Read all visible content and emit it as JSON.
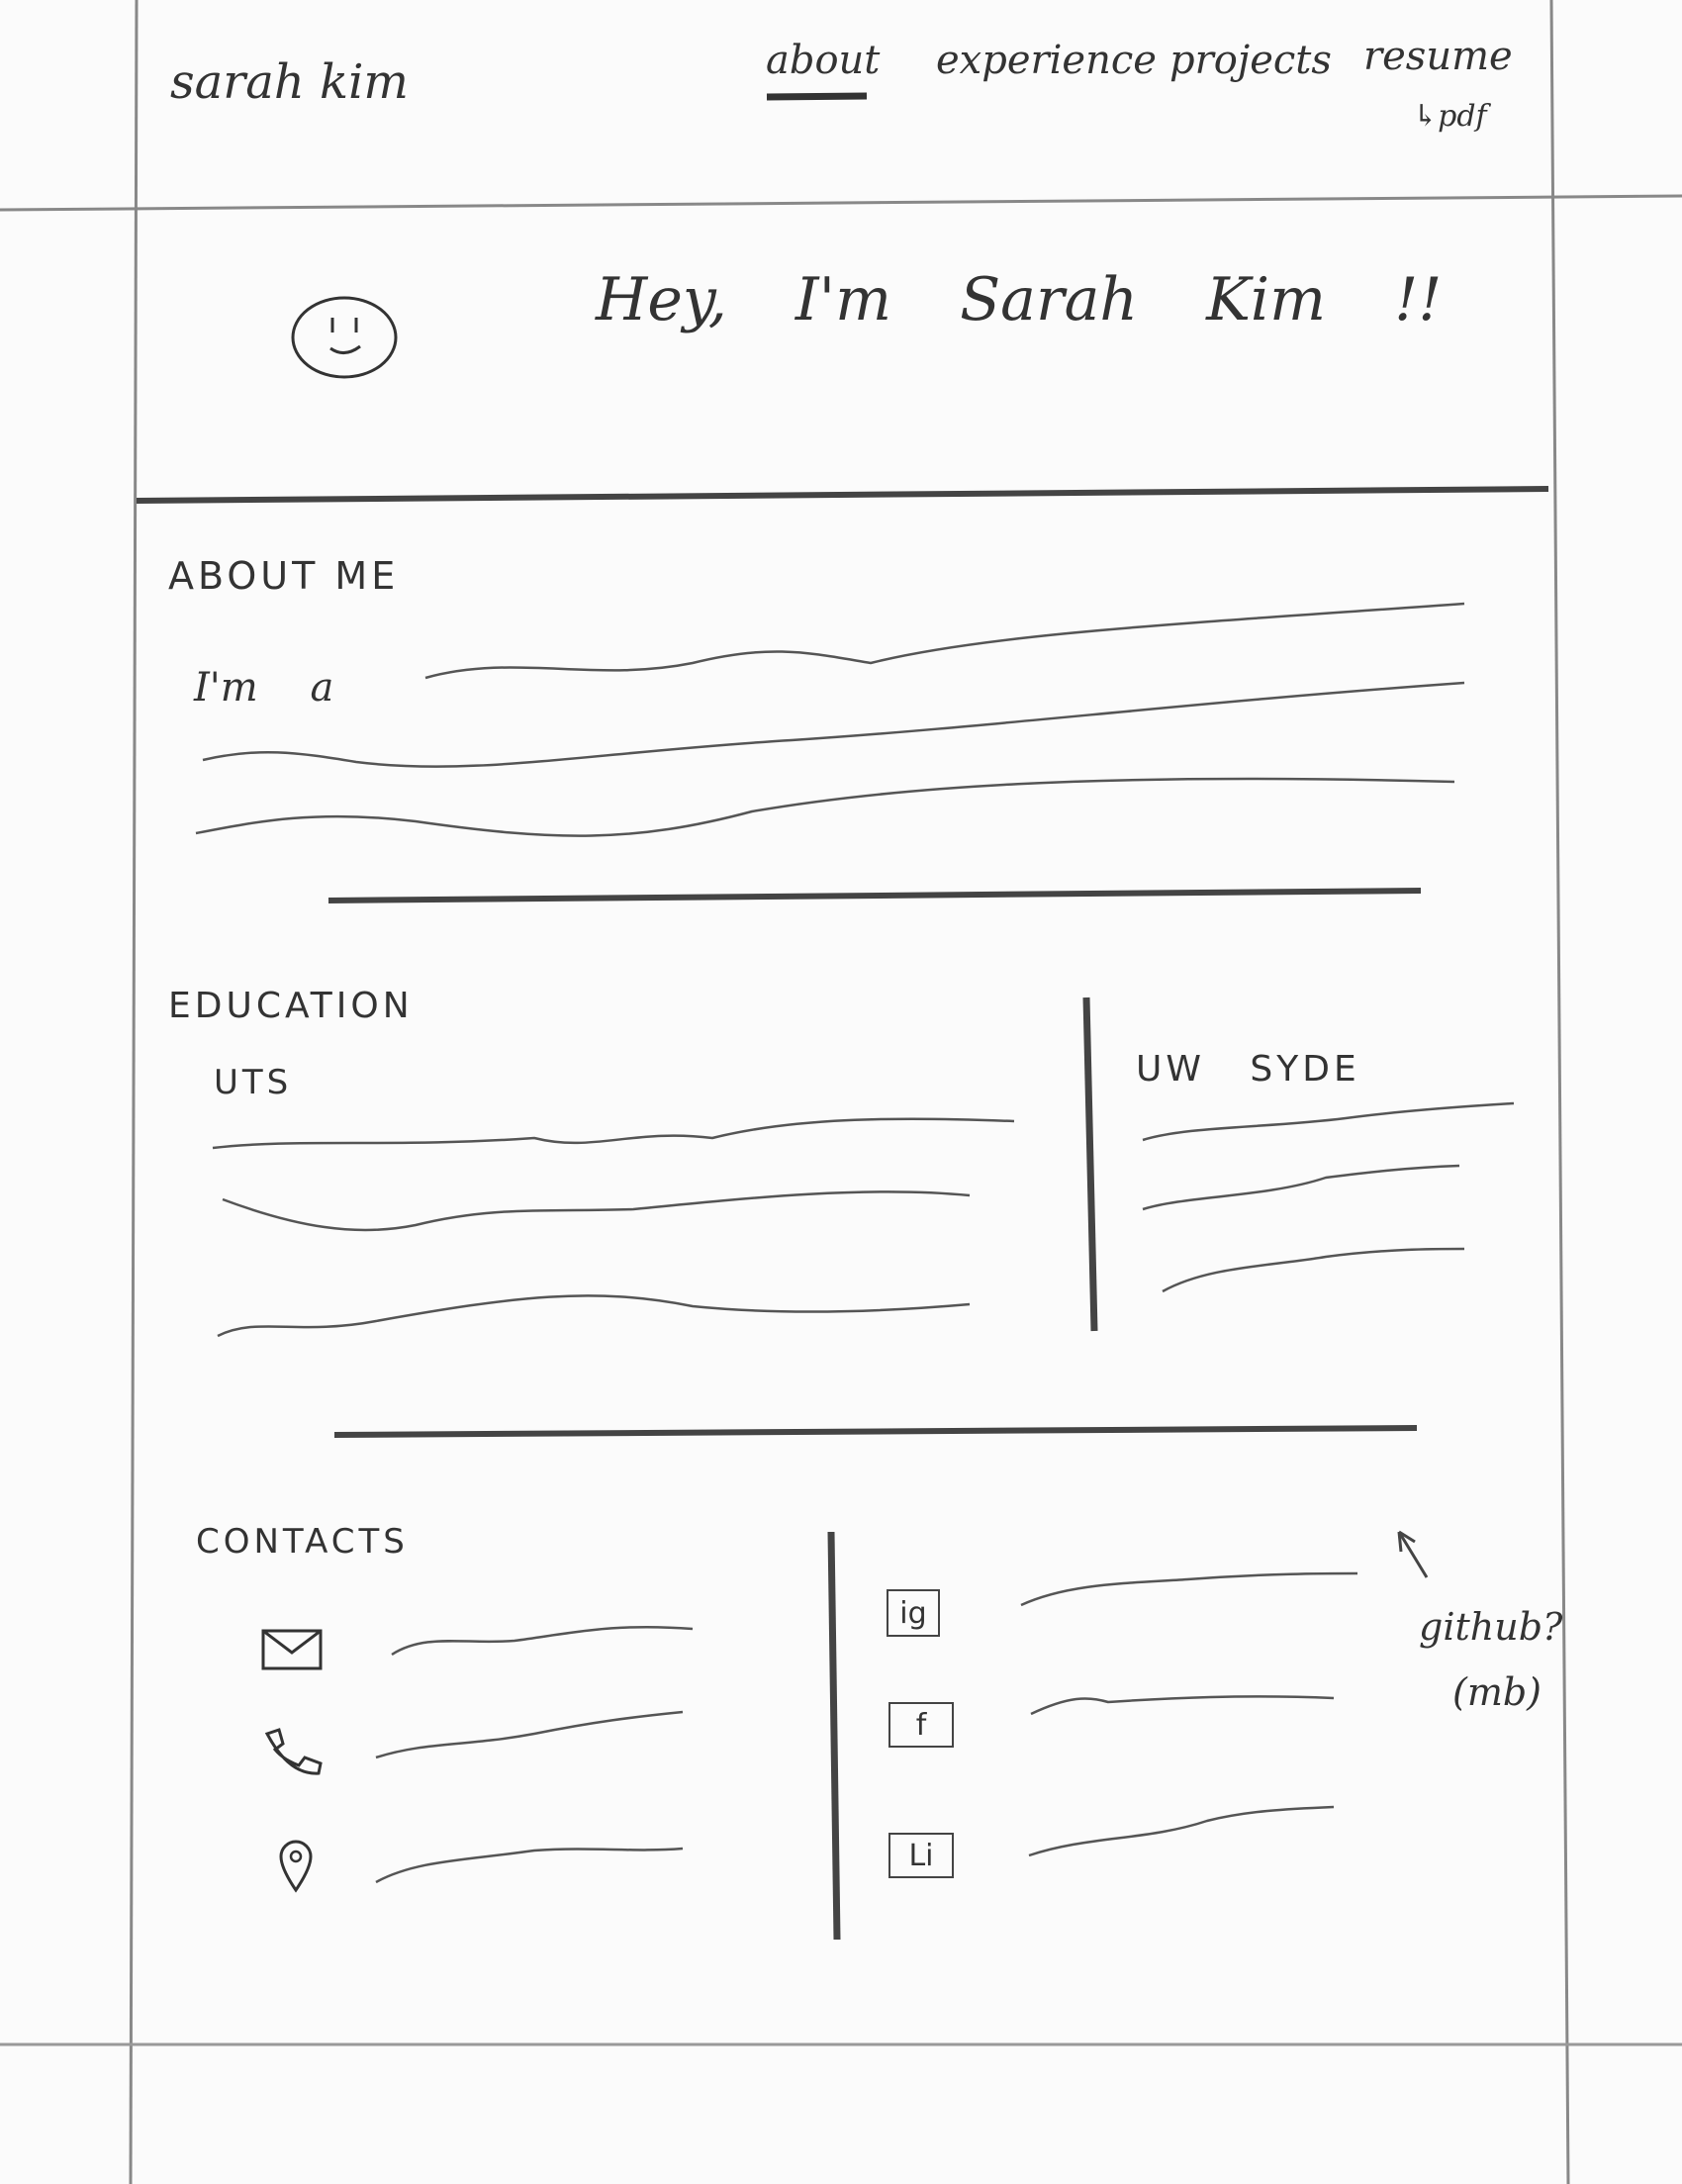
{
  "header": {
    "site_name": "sarah kim",
    "nav": [
      {
        "label": "about",
        "active": true
      },
      {
        "label": "experience",
        "active": false
      },
      {
        "label": "projects",
        "active": false
      },
      {
        "label": "resume",
        "active": false
      }
    ],
    "resume_note": "↳pdf"
  },
  "hero": {
    "avatar_icon": "smiley-face-icon",
    "greeting": "Hey, I'm Sarah Kim !!"
  },
  "about": {
    "heading": "ABOUT ME",
    "intro": "I'm a"
  },
  "education": {
    "heading": "EDUCATION",
    "left_title": "UTS",
    "right_title": "UW SYDE"
  },
  "contacts": {
    "heading": "CONTACTS",
    "items": [
      {
        "icon": "mail-icon"
      },
      {
        "icon": "phone-icon"
      },
      {
        "icon": "location-pin-icon"
      }
    ],
    "social": [
      {
        "label": "ig",
        "icon": "instagram-icon"
      },
      {
        "label": "f",
        "icon": "facebook-icon"
      },
      {
        "label": "Li",
        "icon": "linkedin-icon"
      }
    ],
    "annotation_line1": "github?",
    "annotation_line2": "(mb)"
  }
}
